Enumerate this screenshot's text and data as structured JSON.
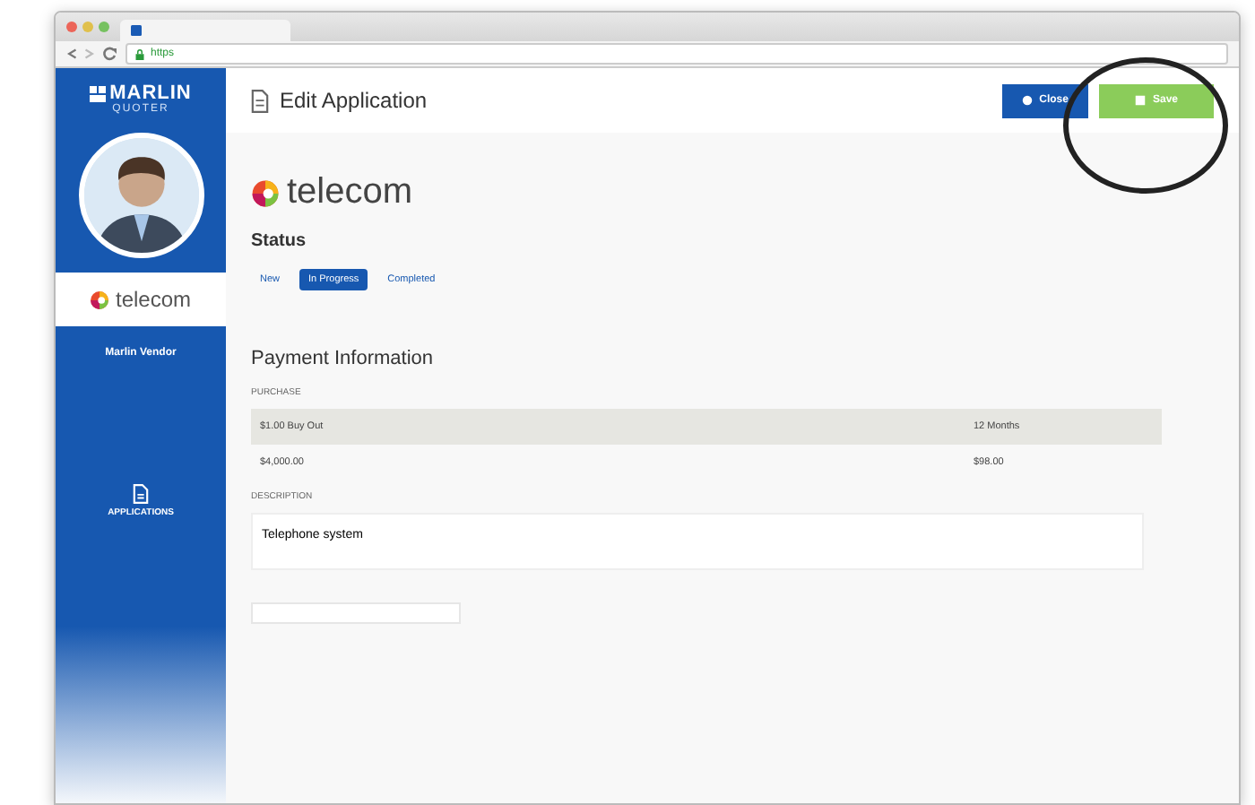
{
  "browser": {
    "url_scheme": "https"
  },
  "sidebar": {
    "logo": {
      "title": "MARLIN",
      "subtitle": "QUOTER"
    },
    "brand": "telecom",
    "user_name": "Marlin Vendor",
    "nav": [
      {
        "label": "APPLICATIONS",
        "selected": true
      }
    ]
  },
  "header": {
    "title": "Edit Application",
    "buttons": [
      {
        "label": "Close",
        "kind": "primary"
      },
      {
        "label": "Save",
        "kind": "success",
        "highlighted": true
      }
    ]
  },
  "brand": "telecom",
  "status": {
    "heading": "Status",
    "options": [
      {
        "label": "New",
        "selected": false
      },
      {
        "label": "In Progress",
        "selected": true
      },
      {
        "label": "Completed",
        "selected": false
      }
    ]
  },
  "payment": {
    "heading": "Payment Information",
    "purchase_label": "PURCHASE",
    "rows": [
      [
        "$1.00 Buy Out",
        "12 Months"
      ],
      [
        "$4,000.00",
        "$98.00"
      ]
    ],
    "description_label": "DESCRIPTION",
    "description": "Telephone system"
  }
}
